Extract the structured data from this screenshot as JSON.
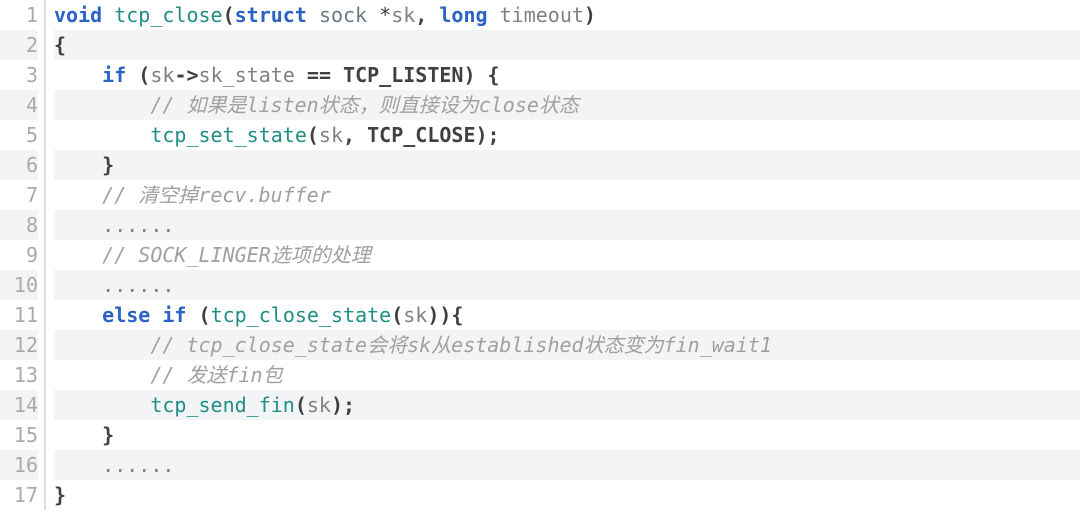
{
  "language": "c",
  "lines": [
    {
      "num": "1",
      "alt": false,
      "indent": 0,
      "tokens": [
        {
          "t": "void",
          "c": "vd"
        },
        {
          "t": " ",
          "c": null
        },
        {
          "t": "tcp_close",
          "c": "fn"
        },
        {
          "t": "(",
          "c": "pun"
        },
        {
          "t": "struct",
          "c": "kw"
        },
        {
          "t": " ",
          "c": null
        },
        {
          "t": "sock",
          "c": "ty"
        },
        {
          "t": " ",
          "c": null
        },
        {
          "t": "*",
          "c": "star"
        },
        {
          "t": "sk",
          "c": "var"
        },
        {
          "t": ", ",
          "c": "pun"
        },
        {
          "t": "long",
          "c": "kw"
        },
        {
          "t": " ",
          "c": null
        },
        {
          "t": "timeout",
          "c": "var"
        },
        {
          "t": ")",
          "c": "pun"
        }
      ]
    },
    {
      "num": "2",
      "alt": true,
      "indent": 0,
      "tokens": [
        {
          "t": "{",
          "c": "brace"
        }
      ]
    },
    {
      "num": "3",
      "alt": false,
      "indent": 1,
      "tokens": [
        {
          "t": "if",
          "c": "kw"
        },
        {
          "t": " (",
          "c": "pun"
        },
        {
          "t": "sk",
          "c": "var"
        },
        {
          "t": "->",
          "c": "pun"
        },
        {
          "t": "sk_state",
          "c": "var"
        },
        {
          "t": " == ",
          "c": "pun"
        },
        {
          "t": "TCP_LISTEN",
          "c": "cnst"
        },
        {
          "t": ") {",
          "c": "pun"
        }
      ]
    },
    {
      "num": "4",
      "alt": true,
      "indent": 2,
      "tokens": [
        {
          "t": "// 如果是listen状态，则直接设为close状态",
          "c": "cmt"
        }
      ]
    },
    {
      "num": "5",
      "alt": false,
      "indent": 2,
      "tokens": [
        {
          "t": "tcp_set_state",
          "c": "fn"
        },
        {
          "t": "(",
          "c": "pun"
        },
        {
          "t": "sk",
          "c": "var"
        },
        {
          "t": ", ",
          "c": "pun"
        },
        {
          "t": "TCP_CLOSE",
          "c": "cnst"
        },
        {
          "t": ");",
          "c": "pun"
        }
      ]
    },
    {
      "num": "6",
      "alt": true,
      "indent": 1,
      "tokens": [
        {
          "t": "}",
          "c": "brace"
        }
      ]
    },
    {
      "num": "7",
      "alt": false,
      "indent": 1,
      "tokens": [
        {
          "t": "// 清空掉recv.buffer",
          "c": "cmt"
        }
      ]
    },
    {
      "num": "8",
      "alt": true,
      "indent": 1,
      "tokens": [
        {
          "t": "......",
          "c": "var"
        }
      ]
    },
    {
      "num": "9",
      "alt": false,
      "indent": 1,
      "tokens": [
        {
          "t": "// SOCK_LINGER选项的处理",
          "c": "cmt"
        }
      ]
    },
    {
      "num": "10",
      "alt": true,
      "indent": 1,
      "tokens": [
        {
          "t": "......",
          "c": "var"
        }
      ]
    },
    {
      "num": "11",
      "alt": false,
      "indent": 1,
      "tokens": [
        {
          "t": "else",
          "c": "kw"
        },
        {
          "t": " ",
          "c": null
        },
        {
          "t": "if",
          "c": "kw"
        },
        {
          "t": " (",
          "c": "pun"
        },
        {
          "t": "tcp_close_state",
          "c": "fn"
        },
        {
          "t": "(",
          "c": "pun"
        },
        {
          "t": "sk",
          "c": "var"
        },
        {
          "t": ")){",
          "c": "pun"
        }
      ]
    },
    {
      "num": "12",
      "alt": true,
      "indent": 2,
      "tokens": [
        {
          "t": "// tcp_close_state会将sk从established状态变为fin_wait1",
          "c": "cmt"
        }
      ]
    },
    {
      "num": "13",
      "alt": false,
      "indent": 2,
      "tokens": [
        {
          "t": "// 发送fin包",
          "c": "cmt"
        }
      ]
    },
    {
      "num": "14",
      "alt": true,
      "indent": 2,
      "tokens": [
        {
          "t": "tcp_send_fin",
          "c": "fn"
        },
        {
          "t": "(",
          "c": "pun"
        },
        {
          "t": "sk",
          "c": "var"
        },
        {
          "t": ");",
          "c": "pun"
        }
      ]
    },
    {
      "num": "15",
      "alt": false,
      "indent": 1,
      "tokens": [
        {
          "t": "}",
          "c": "brace"
        }
      ]
    },
    {
      "num": "16",
      "alt": true,
      "indent": 1,
      "tokens": [
        {
          "t": "......",
          "c": "var"
        }
      ]
    },
    {
      "num": "17",
      "alt": false,
      "indent": 0,
      "tokens": [
        {
          "t": "}",
          "c": "brace"
        }
      ]
    }
  ],
  "indent_unit": "    "
}
